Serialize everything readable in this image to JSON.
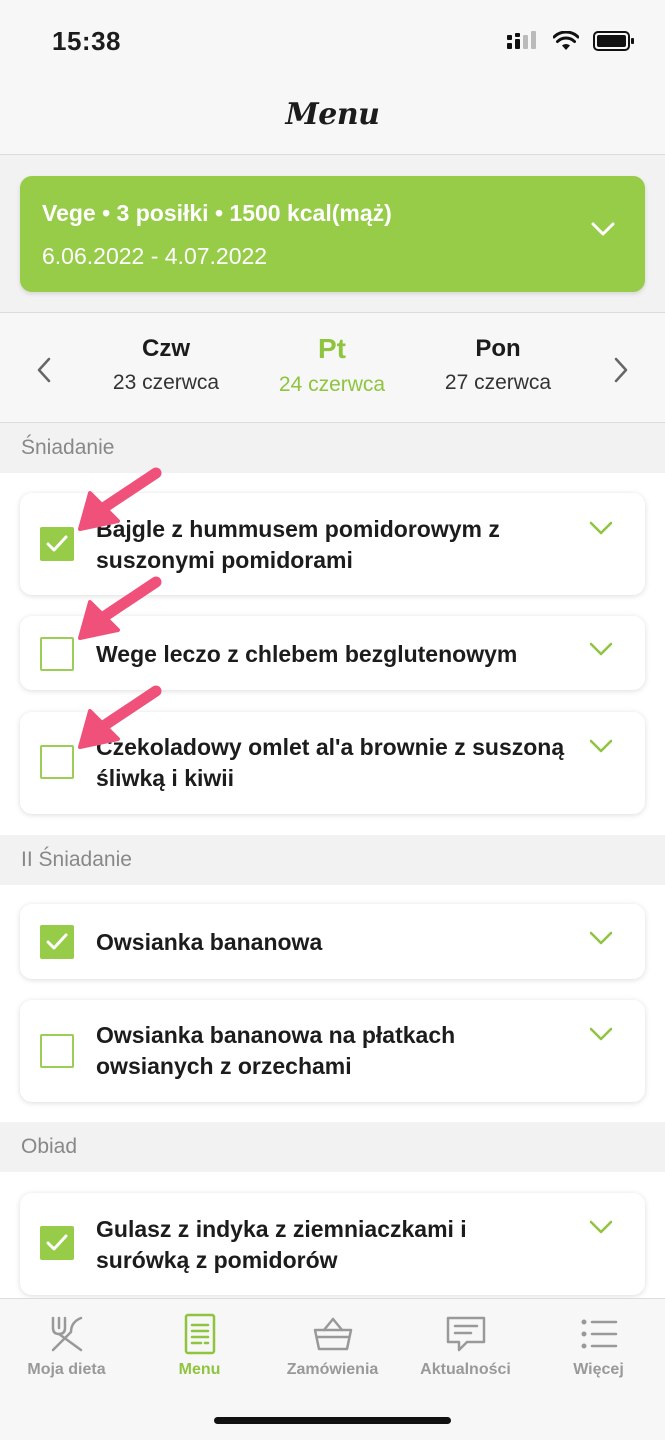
{
  "status": {
    "time": "15:38"
  },
  "header": {
    "title": "Menu"
  },
  "plan": {
    "title": "Vege • 3 posiłki • 1500 kcal(mąż)",
    "dates": "6.06.2022 - 4.07.2022"
  },
  "days": [
    {
      "name": "Czw",
      "date": "23 czerwca"
    },
    {
      "name": "Pt",
      "date": "24 czerwca"
    },
    {
      "name": "Pon",
      "date": "27 czerwca"
    }
  ],
  "sections": [
    {
      "title": "Śniadanie",
      "meals": [
        {
          "name": "Bajgle z hummusem pomidorowym z suszonymi pomidorami",
          "checked": true
        },
        {
          "name": "Wege leczo z chlebem bezglutenowym",
          "checked": false
        },
        {
          "name": "Czekoladowy omlet al'a brownie z suszoną śliwką i kiwii",
          "checked": false
        }
      ]
    },
    {
      "title": "II Śniadanie",
      "meals": [
        {
          "name": "Owsianka bananowa",
          "checked": true
        },
        {
          "name": "Owsianka bananowa na płatkach owsianych  z orzechami",
          "checked": false
        }
      ]
    },
    {
      "title": "Obiad",
      "meals": [
        {
          "name": "Gulasz z indyka z ziemniaczkami i surówką z pomidorów",
          "checked": true
        }
      ]
    }
  ],
  "tabs": [
    {
      "label": "Moja dieta",
      "icon": "cutlery-icon"
    },
    {
      "label": "Menu",
      "icon": "document-icon"
    },
    {
      "label": "Zamówienia",
      "icon": "basket-icon"
    },
    {
      "label": "Aktualności",
      "icon": "chat-icon"
    },
    {
      "label": "Więcej",
      "icon": "list-icon"
    }
  ],
  "colors": {
    "accent": "#97cc49",
    "arrow": "#f0517a",
    "muted": "#999999"
  }
}
